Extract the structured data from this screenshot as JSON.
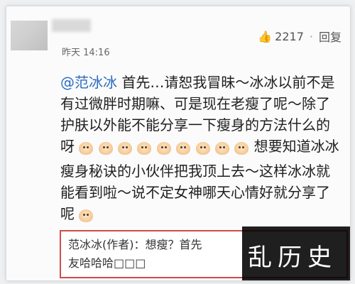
{
  "header": {
    "time": "昨天 14:16",
    "likes": "2217",
    "reply_label": "回复",
    "separator": "·"
  },
  "post": {
    "mention": "@范冰冰",
    "line1_rest": " 首先…请恕我冒昧～冰冰以前不是",
    "line2": "有过微胖时期嘛、可是现在老瘦了呢～除了",
    "line3": "护肤以外能不能分享一下瘦身的方法什么的",
    "line4_start": "呀",
    "line4_after_emoji": "想要知道冰冰",
    "line5": "瘦身秘诀的小伙伴把我顶上去～这样冰冰就",
    "line6": "能看到啦～说不定女神哪天心情好就分享了",
    "line7": "呢",
    "emoji_icon": "laugh-emoji"
  },
  "reply": {
    "author": "范冰冰(作者)",
    "line1": "：想瘦？首先",
    "line2": "友哈哈哈□□□"
  },
  "watermark": {
    "text": "乱历史"
  }
}
